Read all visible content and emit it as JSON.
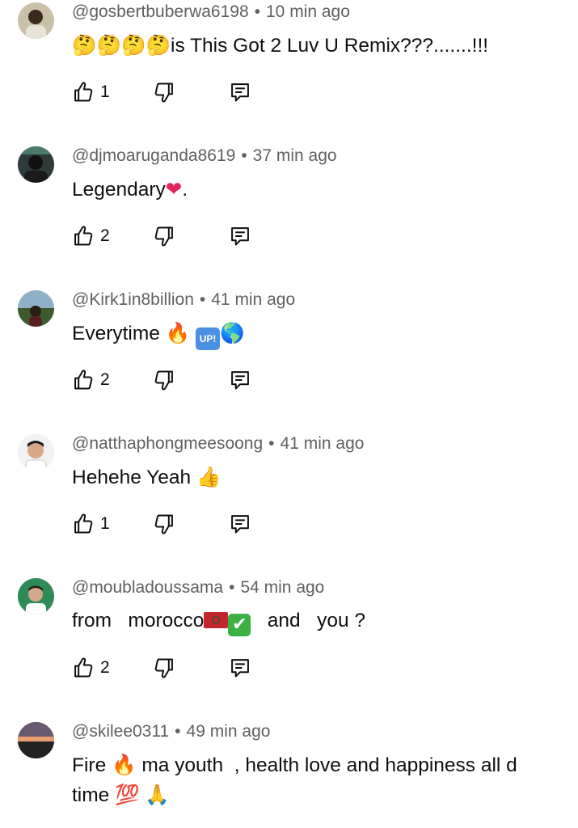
{
  "comments": [
    {
      "handle": "@gosbertbuberwa6198",
      "time": "10 min ago",
      "text_emoji": "🤔🤔🤔🤔",
      "text": "is This Got 2 Luv U Remix???.......!!!",
      "likes": "1"
    },
    {
      "handle": "@djmoaruganda8619",
      "time": "37 min ago",
      "text": "Legendary",
      "text_emoji": "❤",
      "text_after": ".",
      "likes": "2"
    },
    {
      "handle": "@Kirk1in8billion",
      "time": "41 min ago",
      "text": "Everytime ",
      "text_emoji_1": "🔥",
      "text_emoji_2": "UP!",
      "text_emoji_3": "🌎",
      "likes": "2"
    },
    {
      "handle": "@natthaphongmeesoong",
      "time": "41 min ago",
      "text": "Hehehe Yeah ",
      "text_emoji": "👍",
      "likes": "1"
    },
    {
      "handle": "@moubladoussama",
      "time": "54 min ago",
      "text": "from   morocco",
      "text_emoji": "✔",
      "text_after": "   and   you ?",
      "likes": "2"
    },
    {
      "handle": "@skilee0311",
      "time": "49 min ago",
      "text_before": "Fire ",
      "text_emoji_1": "🔥",
      "text": " ma youth  , health love and happiness all d time ",
      "text_emoji_2": "💯",
      "text_emoji_3": "🙏"
    }
  ],
  "icons": {
    "like": "thumbs-up-icon",
    "dislike": "thumbs-down-icon",
    "reply": "reply-comment-icon"
  },
  "colors": {
    "meta": "#606060",
    "text": "#0f0f0f",
    "fire": "#ff6a00",
    "heart": "#e0245e"
  }
}
